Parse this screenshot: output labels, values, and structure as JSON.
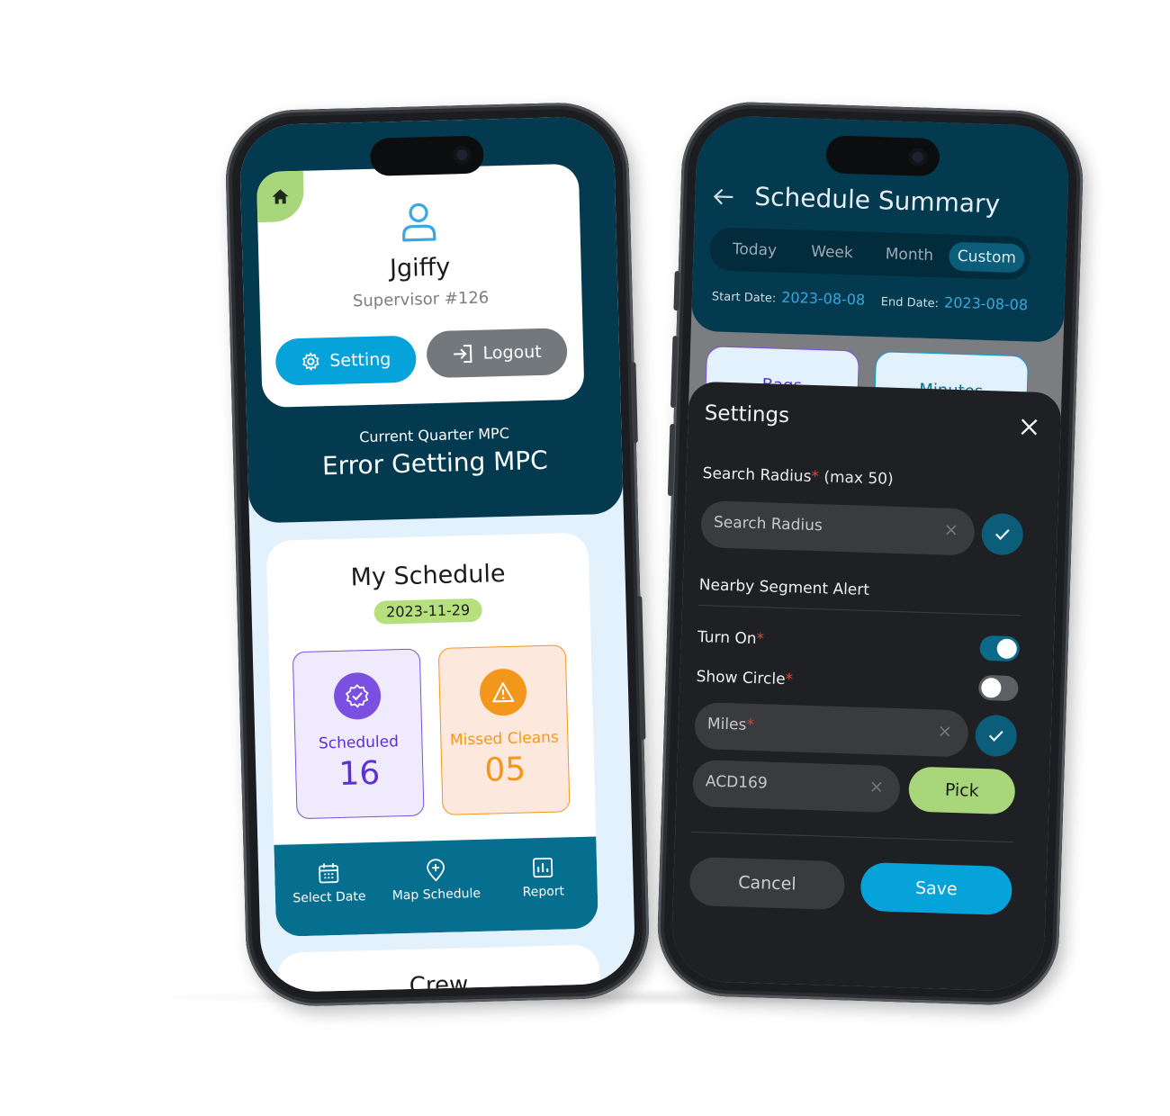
{
  "left_phone": {
    "profile": {
      "name": "Jgiffy",
      "role": "Supervisor #126",
      "setting_label": "Setting",
      "logout_label": "Logout"
    },
    "mpc": {
      "label": "Current Quarter MPC",
      "value": "Error Getting MPC"
    },
    "schedule": {
      "title": "My Schedule",
      "date": "2023-11-29",
      "scheduled_label": "Scheduled",
      "scheduled_count": "16",
      "missed_label": "Missed Cleans",
      "missed_count": "05"
    },
    "nav": {
      "select_date": "Select Date",
      "map_schedule": "Map Schedule",
      "report": "Report"
    },
    "crew_title": "Crew"
  },
  "right_phone": {
    "title": "Schedule Summary",
    "tabs": [
      "Today",
      "Week",
      "Month",
      "Custom"
    ],
    "active_tab": "Custom",
    "start_date_label": "Start Date:",
    "start_date": "2023-08-08",
    "end_date_label": "End Date:",
    "end_date": "2023-08-08",
    "tile_bags": "Bags",
    "tile_minutes": "Minutes",
    "settings": {
      "title": "Settings",
      "search_radius_label": "Search Radius",
      "search_radius_hint": "(max 50)",
      "search_radius_placeholder": "Search Radius",
      "nearby_alert_label": "Nearby Segment Alert",
      "turn_on_label": "Turn On",
      "turn_on_state": true,
      "show_circle_label": "Show Circle",
      "show_circle_state": false,
      "miles_placeholder": "Miles",
      "segment_value": "ACD169",
      "pick_label": "Pick",
      "cancel_label": "Cancel",
      "save_label": "Save"
    }
  },
  "colors": {
    "navy": "#033a4f",
    "accent_blue": "#06a2da",
    "lime": "#a8d67a",
    "purple": "#7b4fe0",
    "orange": "#f2971b",
    "teal_nav": "#066e8f",
    "sheet_dark": "#1f2023"
  }
}
